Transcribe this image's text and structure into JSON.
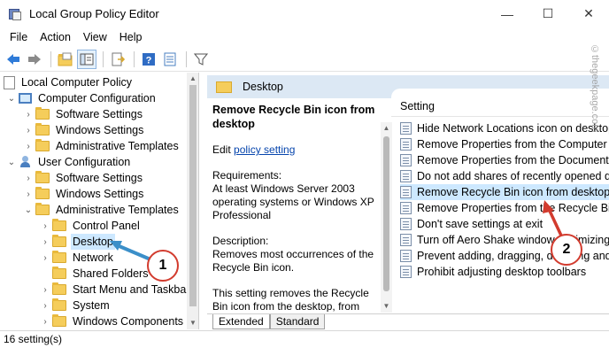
{
  "window": {
    "title": "Local Group Policy Editor",
    "controls": {
      "minimize": "—",
      "maximize": "☐",
      "close": "✕"
    }
  },
  "menu": [
    "File",
    "Action",
    "View",
    "Help"
  ],
  "toolbar": {
    "icons": [
      "back-arrow-icon",
      "forward-arrow-icon",
      "up-folder-icon",
      "show-hide-tree-icon",
      "export-list-icon",
      "help-icon",
      "properties-icon",
      "filter-icon"
    ]
  },
  "tree": {
    "root": "Local Computer Policy",
    "computer_config": "Computer Configuration",
    "cc_software": "Software Settings",
    "cc_windows": "Windows Settings",
    "cc_admin": "Administrative Templates",
    "user_config": "User Configuration",
    "uc_software": "Software Settings",
    "uc_windows": "Windows Settings",
    "uc_admin": "Administrative Templates",
    "control_panel": "Control Panel",
    "desktop": "Desktop",
    "network": "Network",
    "shared_folders": "Shared Folders",
    "start_menu": "Start Menu and Taskbar",
    "system": "System",
    "windows_components": "Windows Components"
  },
  "header": {
    "title": "Desktop"
  },
  "description": {
    "title": "Remove Recycle Bin icon from desktop",
    "edit_prefix": "Edit",
    "edit_link": "policy setting",
    "requirements_label": "Requirements:",
    "requirements_text": "At least Windows Server 2003 operating systems or Windows XP Professional",
    "description_label": "Description:",
    "description_text": "Removes most occurrences of the Recycle Bin icon.",
    "more_text": "This setting removes the Recycle Bin icon from the desktop, from"
  },
  "list": {
    "column_header": "Setting",
    "items": [
      "Hide Network Locations icon on desktop",
      "Remove Properties from the Computer icon",
      "Remove Properties from the Documents icon",
      "Do not add shares of recently opened documents",
      "Remove Recycle Bin icon from desktop",
      "Remove Properties from the Recycle Bin context menu",
      "Don't save settings at exit",
      "Turn off Aero Shake window minimizing mouse gesture",
      "Prevent adding, dragging, dropping and closing",
      "Prohibit adjusting desktop toolbars"
    ],
    "selected_index": 4
  },
  "tabs": [
    "Extended",
    "Standard"
  ],
  "status": {
    "text": "16 setting(s)"
  },
  "watermark": "©thegeekpage.com",
  "annotations": {
    "badge1": "1",
    "badge2": "2",
    "color": "#d23b2e",
    "arrow1_color": "#3b8fc9"
  }
}
